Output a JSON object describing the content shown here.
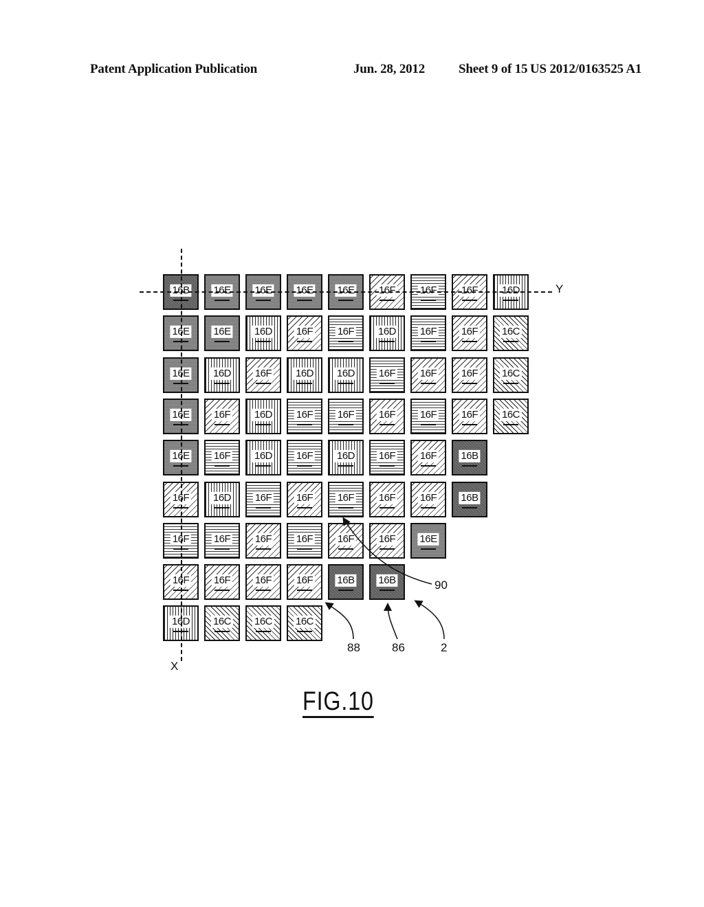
{
  "header": {
    "publication": "Patent Application Publication",
    "date": "Jun. 28, 2012",
    "sheet": "Sheet 9 of 15",
    "number": "US 2012/0163525 A1"
  },
  "figure": {
    "label": "FIG.10",
    "axis_x_label": "X",
    "axis_y_label": "Y",
    "reference_numerals": [
      "90",
      "88",
      "86",
      "2"
    ],
    "legend_patterns": {
      "16B": "dark diagonal fill",
      "16E": "dark dotted fill",
      "16D": "vertical lines",
      "16F-d": "diagonal dashed lines",
      "16F-h": "horizontal lines",
      "16C": "back-diagonal lines"
    },
    "rows": [
      [
        {
          "t": "16B",
          "p": "B"
        },
        {
          "t": "16E",
          "p": "E"
        },
        {
          "t": "16E",
          "p": "E"
        },
        {
          "t": "16E",
          "p": "E"
        },
        {
          "t": "16E",
          "p": "E"
        },
        {
          "t": "16F",
          "p": "Fd"
        },
        {
          "t": "16F",
          "p": "Fh"
        },
        {
          "t": "16F",
          "p": "Fd"
        },
        {
          "t": "16D",
          "p": "D"
        }
      ],
      [
        {
          "t": "16E",
          "p": "E"
        },
        {
          "t": "16E",
          "p": "E"
        },
        {
          "t": "16D",
          "p": "D"
        },
        {
          "t": "16F",
          "p": "Fd"
        },
        {
          "t": "16F",
          "p": "Fh"
        },
        {
          "t": "16D",
          "p": "D"
        },
        {
          "t": "16F",
          "p": "Fh"
        },
        {
          "t": "16F",
          "p": "Fd"
        },
        {
          "t": "16C",
          "p": "C"
        }
      ],
      [
        {
          "t": "16E",
          "p": "E"
        },
        {
          "t": "16D",
          "p": "D"
        },
        {
          "t": "16F",
          "p": "Fd"
        },
        {
          "t": "16D",
          "p": "D"
        },
        {
          "t": "16D",
          "p": "D"
        },
        {
          "t": "16F",
          "p": "Fh"
        },
        {
          "t": "16F",
          "p": "Fd"
        },
        {
          "t": "16F",
          "p": "Fd"
        },
        {
          "t": "16C",
          "p": "C"
        }
      ],
      [
        {
          "t": "16E",
          "p": "E"
        },
        {
          "t": "16F",
          "p": "Fd"
        },
        {
          "t": "16D",
          "p": "D"
        },
        {
          "t": "16F",
          "p": "Fh"
        },
        {
          "t": "16F",
          "p": "Fh"
        },
        {
          "t": "16F",
          "p": "Fd"
        },
        {
          "t": "16F",
          "p": "Fh"
        },
        {
          "t": "16F",
          "p": "Fd"
        },
        {
          "t": "16C",
          "p": "C"
        }
      ],
      [
        {
          "t": "16E",
          "p": "E"
        },
        {
          "t": "16F",
          "p": "Fh"
        },
        {
          "t": "16D",
          "p": "D"
        },
        {
          "t": "16F",
          "p": "Fh"
        },
        {
          "t": "16D",
          "p": "D"
        },
        {
          "t": "16F",
          "p": "Fh"
        },
        {
          "t": "16F",
          "p": "Fd"
        },
        {
          "t": "16B",
          "p": "B"
        }
      ],
      [
        {
          "t": "16F",
          "p": "Fd"
        },
        {
          "t": "16D",
          "p": "D"
        },
        {
          "t": "16F",
          "p": "Fh"
        },
        {
          "t": "16F",
          "p": "Fd"
        },
        {
          "t": "16F",
          "p": "Fh"
        },
        {
          "t": "16F",
          "p": "Fd"
        },
        {
          "t": "16F",
          "p": "Fd"
        },
        {
          "t": "16B",
          "p": "B"
        }
      ],
      [
        {
          "t": "16F",
          "p": "Fh"
        },
        {
          "t": "16F",
          "p": "Fh"
        },
        {
          "t": "16F",
          "p": "Fd"
        },
        {
          "t": "16F",
          "p": "Fh"
        },
        {
          "t": "16F",
          "p": "Fd"
        },
        {
          "t": "16F",
          "p": "Fd"
        },
        {
          "t": "16E",
          "p": "E"
        }
      ],
      [
        {
          "t": "16F",
          "p": "Fd"
        },
        {
          "t": "16F",
          "p": "Fd"
        },
        {
          "t": "16F",
          "p": "Fd"
        },
        {
          "t": "16F",
          "p": "Fd"
        },
        {
          "t": "16B",
          "p": "B"
        },
        {
          "t": "16B",
          "p": "B"
        }
      ],
      [
        {
          "t": "16D",
          "p": "D"
        },
        {
          "t": "16C",
          "p": "C"
        },
        {
          "t": "16C",
          "p": "C"
        },
        {
          "t": "16C",
          "p": "C"
        }
      ]
    ]
  }
}
